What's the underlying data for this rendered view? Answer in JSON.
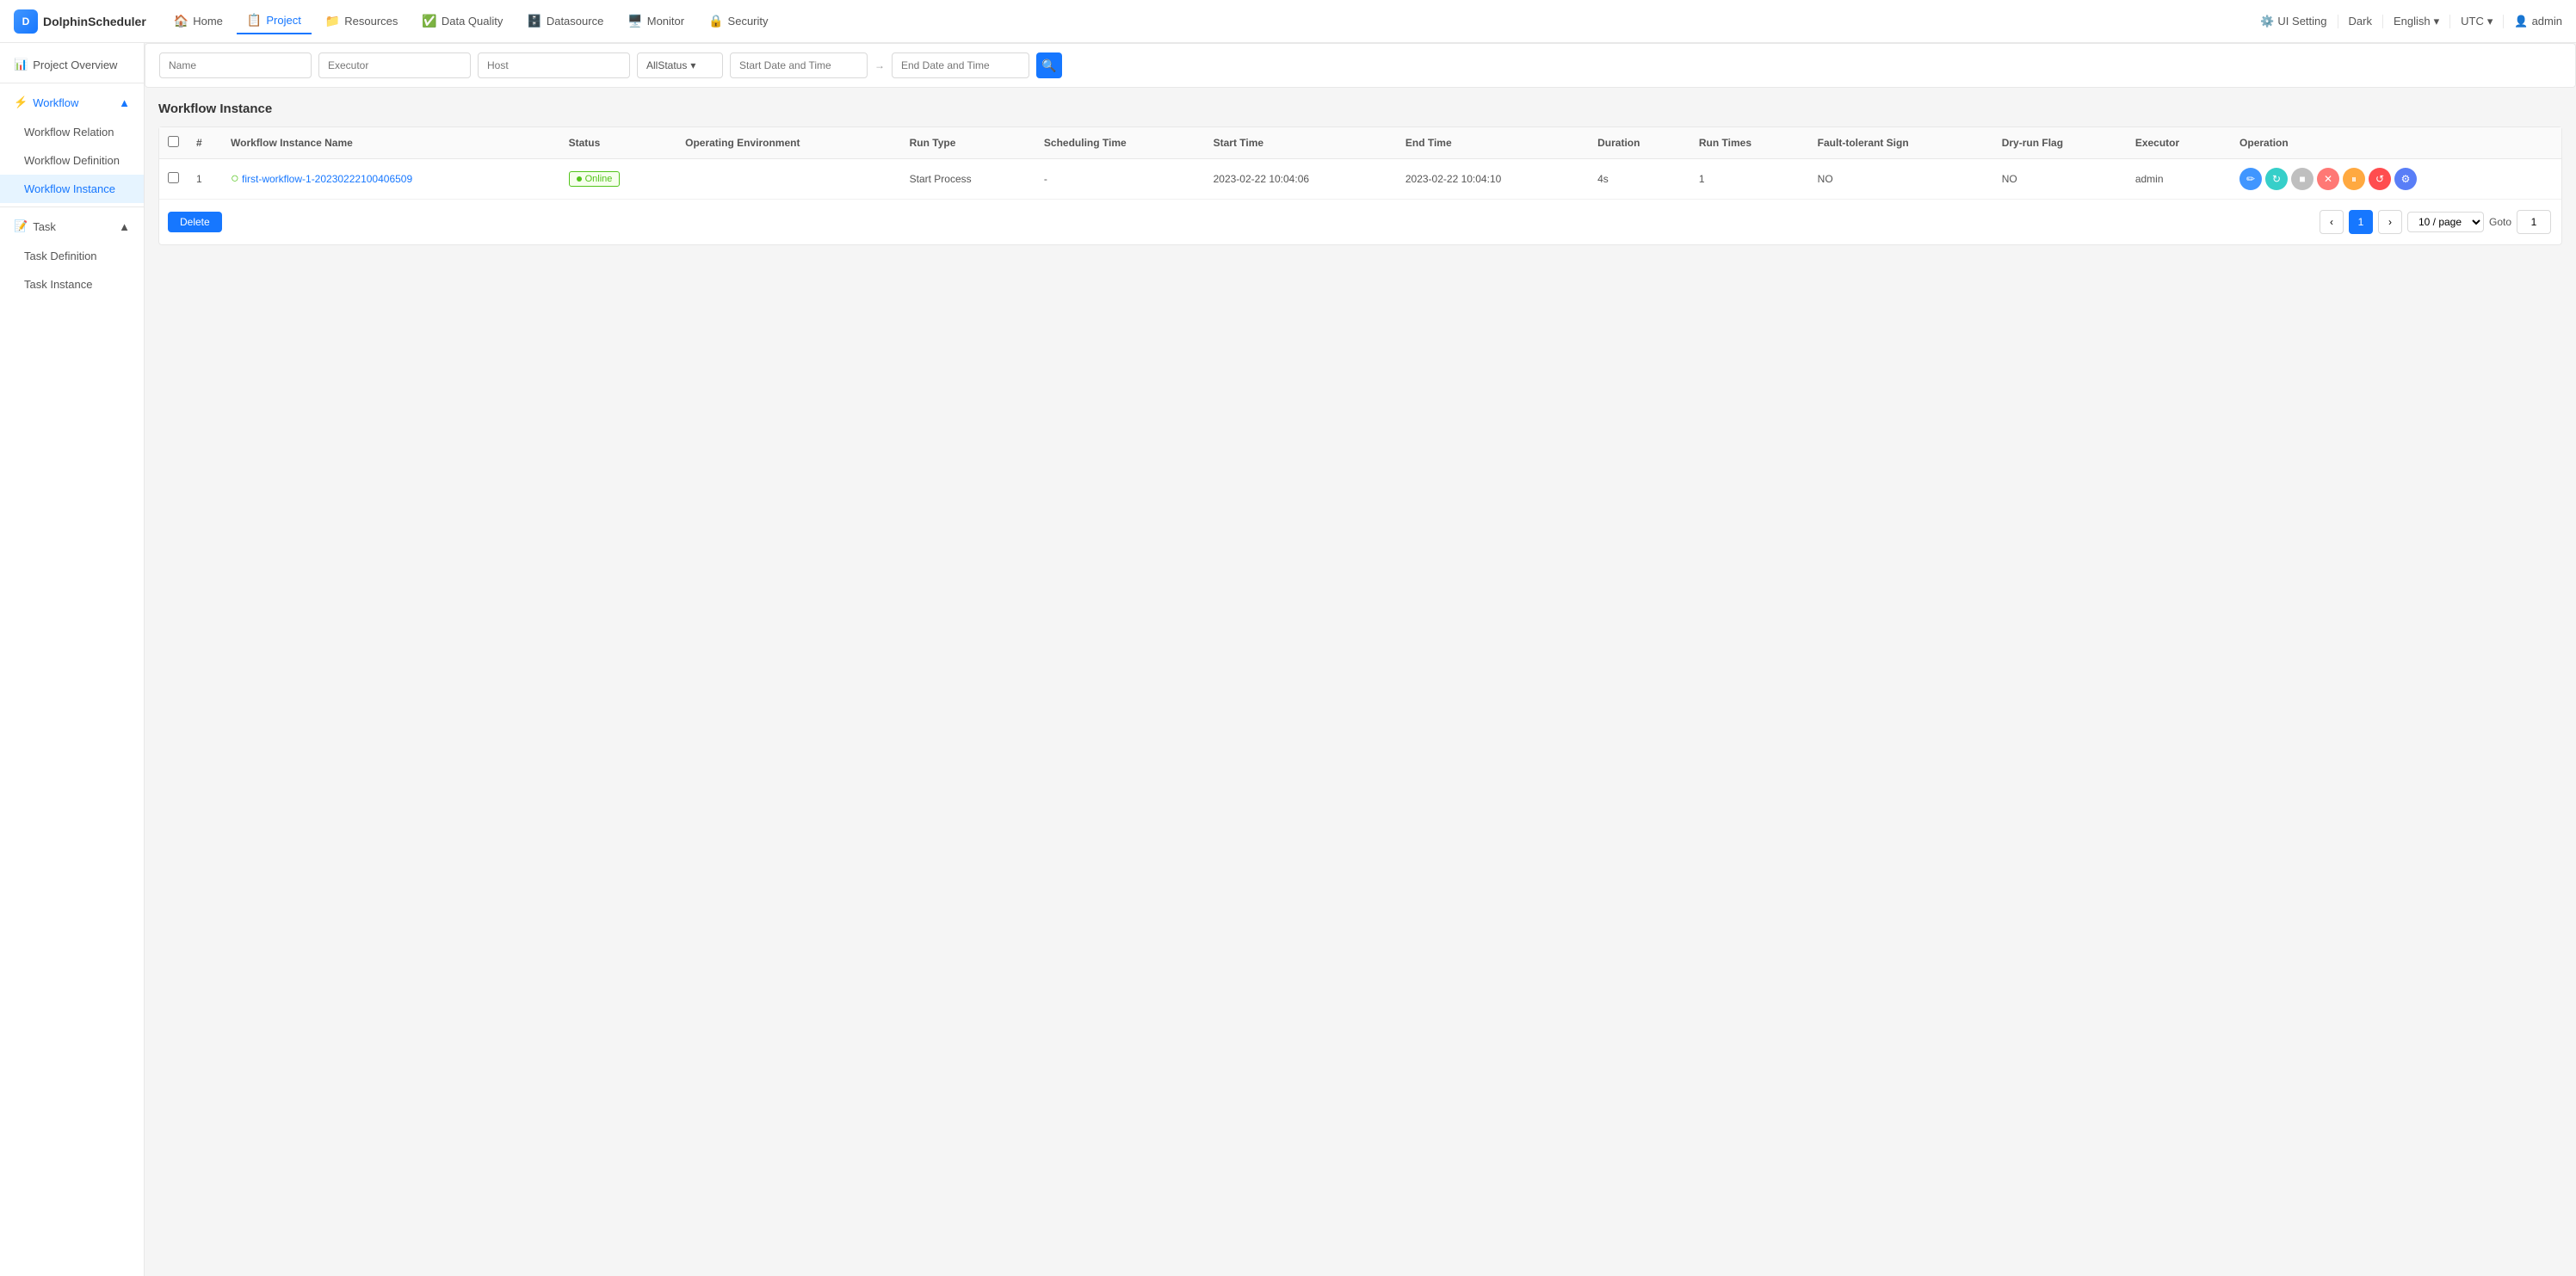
{
  "app": {
    "name": "DolphinScheduler"
  },
  "topNav": {
    "items": [
      {
        "id": "home",
        "label": "Home",
        "icon": "🏠",
        "active": false
      },
      {
        "id": "project",
        "label": "Project",
        "icon": "📋",
        "active": true
      },
      {
        "id": "resources",
        "label": "Resources",
        "icon": "📁",
        "active": false
      },
      {
        "id": "data-quality",
        "label": "Data Quality",
        "icon": "✅",
        "active": false
      },
      {
        "id": "datasource",
        "label": "Datasource",
        "icon": "🗄️",
        "active": false
      },
      {
        "id": "monitor",
        "label": "Monitor",
        "icon": "🖥️",
        "active": false
      },
      {
        "id": "security",
        "label": "Security",
        "icon": "🔒",
        "active": false
      }
    ],
    "right": {
      "uiSetting": "UI Setting",
      "theme": "Dark",
      "language": "English",
      "timezone": "UTC",
      "user": "admin"
    }
  },
  "sidebar": {
    "projectOverview": "Project Overview",
    "workflow": {
      "label": "Workflow",
      "items": [
        {
          "id": "workflow-relation",
          "label": "Workflow Relation",
          "active": false
        },
        {
          "id": "workflow-definition",
          "label": "Workflow Definition",
          "active": false
        },
        {
          "id": "workflow-instance",
          "label": "Workflow Instance",
          "active": true
        }
      ]
    },
    "task": {
      "label": "Task",
      "items": [
        {
          "id": "task-definition",
          "label": "Task Definition",
          "active": false
        },
        {
          "id": "task-instance",
          "label": "Task Instance",
          "active": false
        }
      ]
    }
  },
  "filterBar": {
    "namePlaceholder": "Name",
    "executorPlaceholder": "Executor",
    "hostPlaceholder": "Host",
    "statusLabel": "AllStatus",
    "startDatePlaceholder": "Start Date and Time",
    "arrowLabel": "→",
    "endDatePlaceholder": "End Date and Time"
  },
  "page": {
    "title": "Workflow Instance",
    "deleteButton": "Delete"
  },
  "table": {
    "columns": [
      {
        "id": "checkbox",
        "label": ""
      },
      {
        "id": "num",
        "label": "#"
      },
      {
        "id": "name",
        "label": "Workflow Instance Name"
      },
      {
        "id": "status",
        "label": "Status"
      },
      {
        "id": "operating-env",
        "label": "Operating Environment"
      },
      {
        "id": "run-type",
        "label": "Run Type"
      },
      {
        "id": "scheduling-time",
        "label": "Scheduling Time"
      },
      {
        "id": "start-time",
        "label": "Start Time"
      },
      {
        "id": "end-time",
        "label": "End Time"
      },
      {
        "id": "duration",
        "label": "Duration"
      },
      {
        "id": "run-times",
        "label": "Run Times"
      },
      {
        "id": "fault-tolerant",
        "label": "Fault-tolerant Sign"
      },
      {
        "id": "dry-run",
        "label": "Dry-run Flag"
      },
      {
        "id": "executor",
        "label": "Executor"
      },
      {
        "id": "operation",
        "label": "Operation"
      }
    ],
    "rows": [
      {
        "num": "1",
        "name": "first-workflow-1-20230222100406509",
        "statusIcon": "✓",
        "statusText": "Online",
        "operatingEnv": "",
        "runType": "Start Process",
        "schedulingTime": "-",
        "startTime": "2023-02-22 10:04:06",
        "endTime": "2023-02-22 10:04:10",
        "duration": "4s",
        "runTimes": "1",
        "faultTolerant": "NO",
        "dryRun": "NO",
        "executor": "admin"
      }
    ]
  },
  "pagination": {
    "currentPage": 1,
    "perPage": "10 / page",
    "gotoLabel": "Goto",
    "gotoValue": "1",
    "prevIcon": "‹",
    "nextIcon": "›"
  },
  "operations": {
    "buttons": [
      {
        "id": "edit",
        "title": "Edit",
        "icon": "✏️",
        "color": "#4096ff"
      },
      {
        "id": "rerun",
        "title": "Rerun",
        "icon": "↻",
        "color": "#36cfc9"
      },
      {
        "id": "stop",
        "title": "Stop",
        "icon": "■",
        "color": "#bfbfbf"
      },
      {
        "id": "delete-op",
        "title": "Delete",
        "icon": "✕",
        "color": "#ff7875"
      },
      {
        "id": "pause",
        "title": "Pause",
        "icon": "⏸",
        "color": "#ffa940"
      },
      {
        "id": "recover",
        "title": "Recover",
        "icon": "↺",
        "color": "#ff4d4f"
      },
      {
        "id": "gantt",
        "title": "Gantt",
        "icon": "⚙",
        "color": "#597ef7"
      }
    ]
  }
}
